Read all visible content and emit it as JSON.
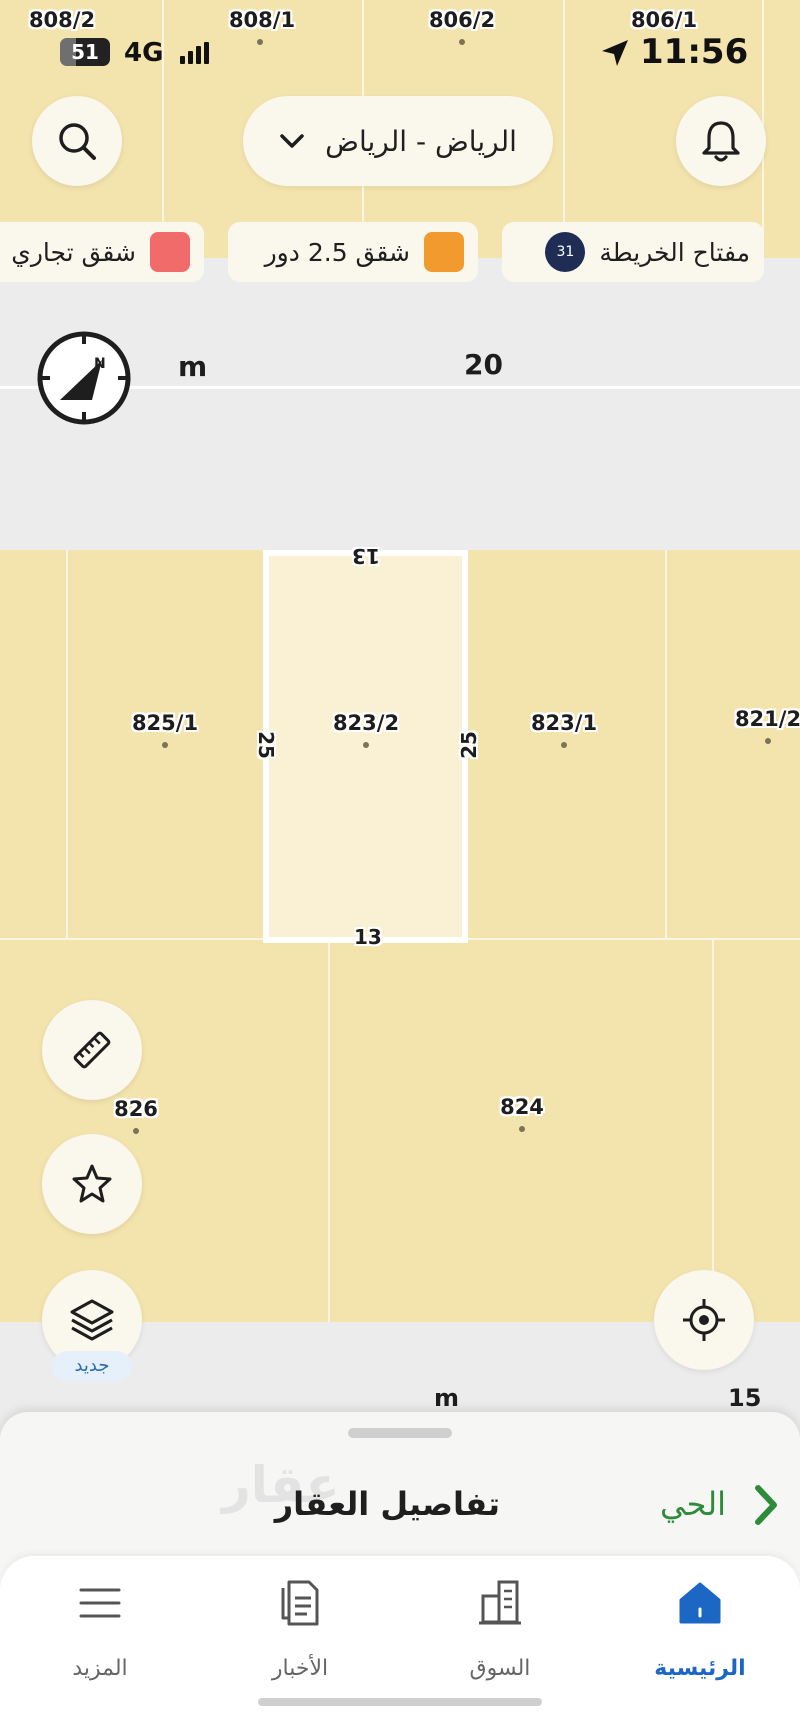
{
  "status_bar": {
    "battery": "51",
    "network": "4G",
    "time": "11:56"
  },
  "header": {
    "city": "الرياض - الرياض",
    "icons": {
      "search": "search-icon",
      "notifications": "bell-icon",
      "dropdown": "chevron-down-icon"
    }
  },
  "legend": {
    "map_key_label": "مفتاح الخريطة",
    "map_key_count": "31",
    "items": [
      {
        "label": "شقق 2.5 دور",
        "color": "#f39a2e"
      },
      {
        "label": "شقق تجاري",
        "color": "#f26b6b"
      }
    ]
  },
  "map": {
    "road_top_label": "20",
    "road_top_unit": "m",
    "road_bottom_label": "15",
    "road_bottom_unit": "m",
    "top_parcels": [
      "808/2",
      "808/1",
      "806/2",
      "806/1"
    ],
    "parcels": [
      {
        "id": "825/1"
      },
      {
        "id": "823/2"
      },
      {
        "id": "823/1"
      },
      {
        "id": "821/2"
      },
      {
        "id": "826"
      },
      {
        "id": "824"
      }
    ],
    "selected_dimensions": {
      "top": "13",
      "bottom": "13",
      "left": "25",
      "right": "25"
    }
  },
  "tools": {
    "measure_icon": "ruler-icon",
    "favorite_icon": "star-icon",
    "layers_icon": "layers-icon",
    "new_badge": "جديد",
    "locate_icon": "crosshair-icon"
  },
  "bottom_sheet": {
    "title": "تفاصيل العقار",
    "watermark": "عقار",
    "district_link": "الحي"
  },
  "tabbar": {
    "tabs": [
      {
        "label": "المزيد",
        "icon": "menu-icon"
      },
      {
        "label": "الأخبار",
        "icon": "news-icon"
      },
      {
        "label": "السوق",
        "icon": "buildings-icon"
      },
      {
        "label": "الرئيسية",
        "icon": "home-icon",
        "active": true
      }
    ]
  },
  "colors": {
    "parcel_fill": "#f3e3ad",
    "road": "#ececec",
    "active_tab": "#1c66c4",
    "district_link": "#2e8b3a"
  }
}
